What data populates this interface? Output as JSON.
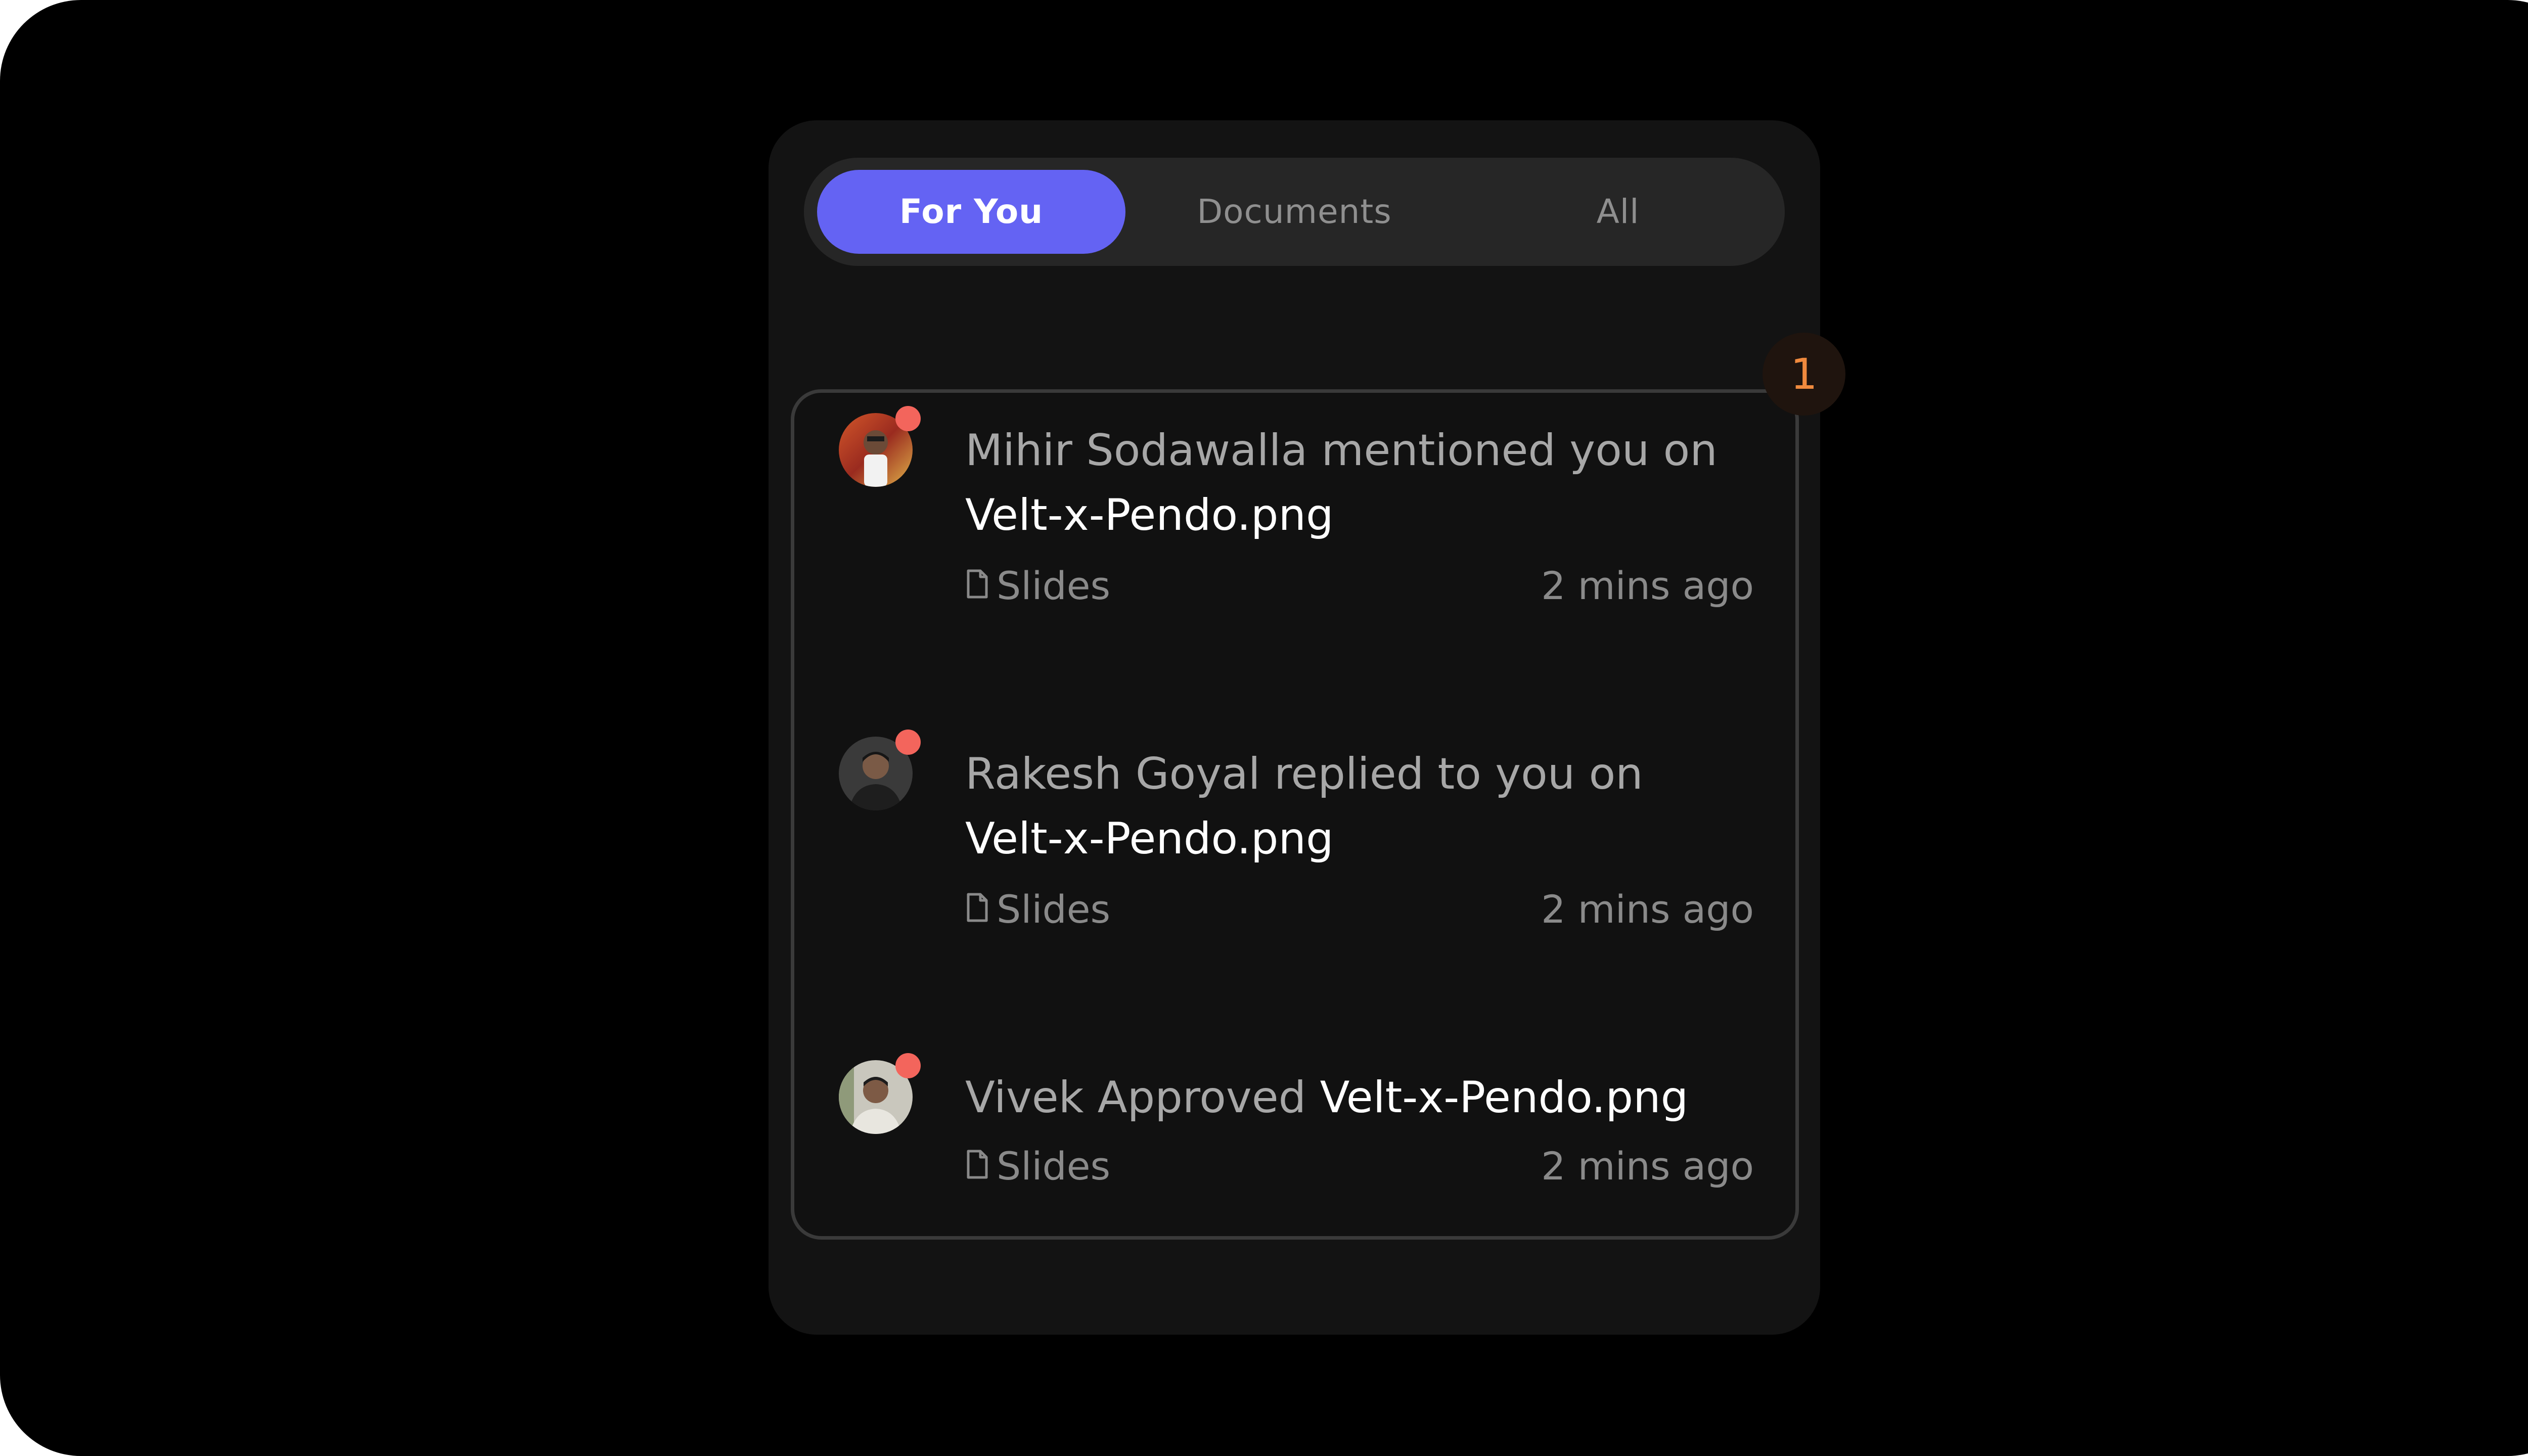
{
  "tabs": [
    {
      "label": "For You",
      "active": true
    },
    {
      "label": "Documents",
      "active": false
    },
    {
      "label": "All",
      "active": false
    }
  ],
  "unread_badge": "1",
  "notifications": [
    {
      "actor_text": "Mihir Sodawalla mentioned you on",
      "document": "Velt-x-Pendo.png",
      "type": "Slides",
      "time": "2 mins ago",
      "unread": true,
      "icon": "file-icon"
    },
    {
      "actor_text": "Rakesh Goyal replied to you on",
      "document": "Velt-x-Pendo.png",
      "type": "Slides",
      "time": "2 mins ago",
      "unread": true,
      "icon": "file-icon"
    },
    {
      "actor_text": "Vivek Approved",
      "document": "Velt-x-Pendo.png",
      "type": "Slides",
      "time": "2 mins ago",
      "unread": true,
      "icon": "file-icon"
    }
  ],
  "colors": {
    "accent": "#6463f3",
    "unread_dot": "#f3655c",
    "badge_text": "#f08a3e",
    "panel_bg": "#131313",
    "page_bg": "#000000"
  }
}
